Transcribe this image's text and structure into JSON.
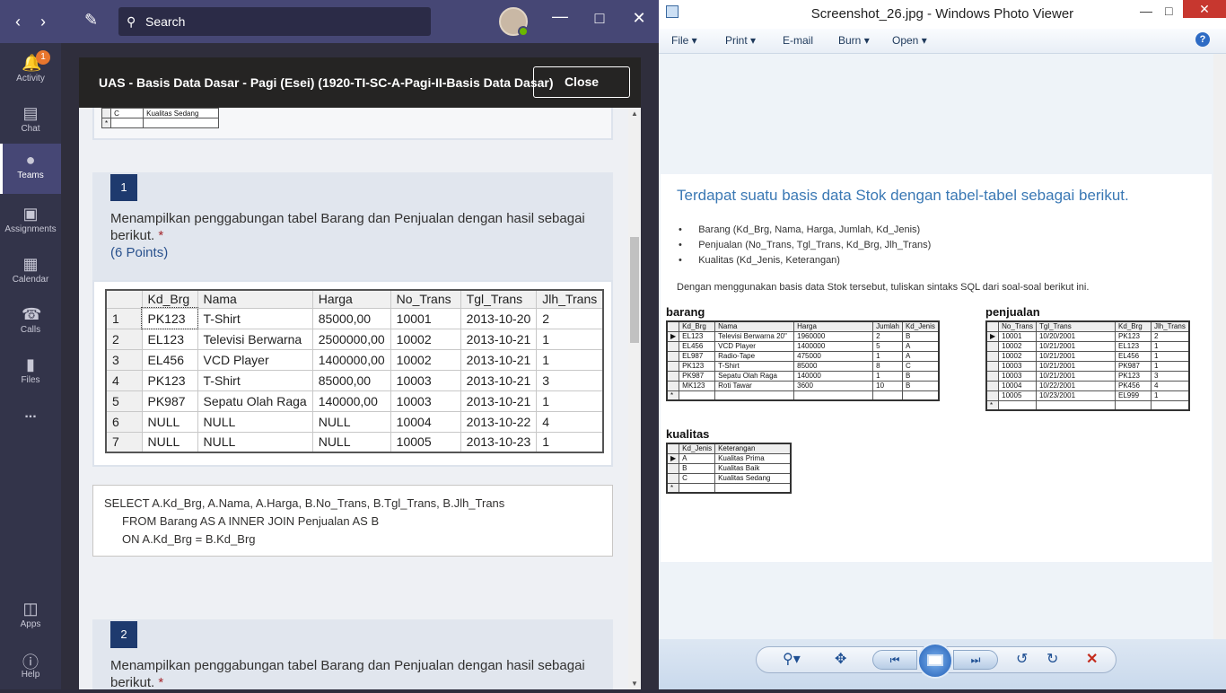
{
  "teams": {
    "search_placeholder": "Search",
    "rail": [
      {
        "label": "Activity",
        "icon": "bell-icon",
        "badge": "1"
      },
      {
        "label": "Chat",
        "icon": "chat-icon"
      },
      {
        "label": "Teams",
        "icon": "teams-icon"
      },
      {
        "label": "Assignments",
        "icon": "assignments-icon"
      },
      {
        "label": "Calendar",
        "icon": "calendar-icon"
      },
      {
        "label": "Calls",
        "icon": "phone-icon"
      },
      {
        "label": "Files",
        "icon": "file-icon"
      },
      {
        "label": "Apps",
        "icon": "apps-icon"
      },
      {
        "label": "Help",
        "icon": "help-icon"
      }
    ],
    "more_label": "...",
    "panel_title": "UAS - Basis Data Dasar - Pagi (Esei) (1920-TI-SC-A-Pagi-II-Basis Data Dasar)",
    "close_label": "Close",
    "top_table": {
      "row": [
        "C",
        "Kualitas Sedang"
      ],
      "new_row": "*"
    },
    "q1": {
      "number": "1",
      "text": "Menampilkan penggabungan tabel Barang dan Penjualan dengan hasil sebagai berikut.",
      "required": "*",
      "points": "(6 Points)",
      "table": {
        "headers": [
          "Kd_Brg",
          "Nama",
          "Harga",
          "No_Trans",
          "Tgl_Trans",
          "Jlh_Trans"
        ],
        "rows": [
          [
            "1",
            "PK123",
            "T-Shirt",
            "85000,00",
            "10001",
            "2013-10-20",
            "2"
          ],
          [
            "2",
            "EL123",
            "Televisi Berwarna",
            "2500000,00",
            "10002",
            "2013-10-21",
            "1"
          ],
          [
            "3",
            "EL456",
            "VCD Player",
            "1400000,00",
            "10002",
            "2013-10-21",
            "1"
          ],
          [
            "4",
            "PK123",
            "T-Shirt",
            "85000,00",
            "10003",
            "2013-10-21",
            "3"
          ],
          [
            "5",
            "PK987",
            "Sepatu Olah Raga",
            "140000,00",
            "10003",
            "2013-10-21",
            "1"
          ],
          [
            "6",
            "NULL",
            "NULL",
            "NULL",
            "10004",
            "2013-10-22",
            "4"
          ],
          [
            "7",
            "NULL",
            "NULL",
            "NULL",
            "10005",
            "2013-10-23",
            "1"
          ]
        ]
      },
      "answer_lines": [
        "SELECT A.Kd_Brg, A.Nama, A.Harga, B.No_Trans, B.Tgl_Trans, B.Jlh_Trans",
        "FROM Barang AS A INNER JOIN Penjualan AS B",
        "ON A.Kd_Brg = B.Kd_Brg"
      ]
    },
    "q2": {
      "number": "2",
      "text": "Menampilkan penggabungan tabel Barang dan Penjualan dengan hasil sebagai berikut.",
      "required": "*"
    }
  },
  "viewer": {
    "title": "Screenshot_26.jpg - Windows Photo Viewer",
    "menu": [
      "File",
      "Print",
      "E-mail",
      "Burn",
      "Open"
    ],
    "heading": "Terdapat suatu basis data Stok dengan tabel-tabel sebagai berikut.",
    "bullets": [
      "Barang (Kd_Brg, Nama, Harga, Jumlah, Kd_Jenis)",
      "Penjualan (No_Trans, Tgl_Trans, Kd_Brg, Jlh_Trans)",
      "Kualitas (Kd_Jenis, Keterangan)"
    ],
    "instruction": "Dengan menggunakan basis data Stok tersebut, tuliskan sintaks SQL dari soal-soal berikut ini.",
    "barang": {
      "title": "barang",
      "headers": [
        "Kd_Brg",
        "Nama",
        "Harga",
        "Jumlah",
        "Kd_Jenis"
      ],
      "rows": [
        [
          "EL123",
          "Televisi Berwarna 20\"",
          "1960000",
          "2",
          "B"
        ],
        [
          "EL456",
          "VCD Player",
          "1400000",
          "5",
          "A"
        ],
        [
          "EL987",
          "Radio-Tape",
          "475000",
          "1",
          "A"
        ],
        [
          "PK123",
          "T-Shirt",
          "85000",
          "8",
          "C"
        ],
        [
          "PK987",
          "Sepatu Olah Raga",
          "140000",
          "1",
          "B"
        ],
        [
          "MK123",
          "Roti Tawar",
          "3600",
          "10",
          "B"
        ]
      ]
    },
    "penjualan": {
      "title": "penjualan",
      "headers": [
        "No_Trans",
        "Tgl_Trans",
        "Kd_Brg",
        "Jlh_Trans"
      ],
      "rows": [
        [
          "10001",
          "10/20/2001",
          "PK123",
          "2"
        ],
        [
          "10002",
          "10/21/2001",
          "EL123",
          "1"
        ],
        [
          "10002",
          "10/21/2001",
          "EL456",
          "1"
        ],
        [
          "10003",
          "10/21/2001",
          "PK987",
          "1"
        ],
        [
          "10003",
          "10/21/2001",
          "PK123",
          "3"
        ],
        [
          "10004",
          "10/22/2001",
          "PK456",
          "4"
        ],
        [
          "10005",
          "10/23/2001",
          "EL999",
          "1"
        ]
      ]
    },
    "kualitas": {
      "title": "kualitas",
      "headers": [
        "Kd_Jenis",
        "Keterangan"
      ],
      "rows": [
        [
          "A",
          "Kualitas Prima"
        ],
        [
          "B",
          "Kualitas Baik"
        ],
        [
          "C",
          "Kualitas Sedang"
        ]
      ]
    }
  }
}
